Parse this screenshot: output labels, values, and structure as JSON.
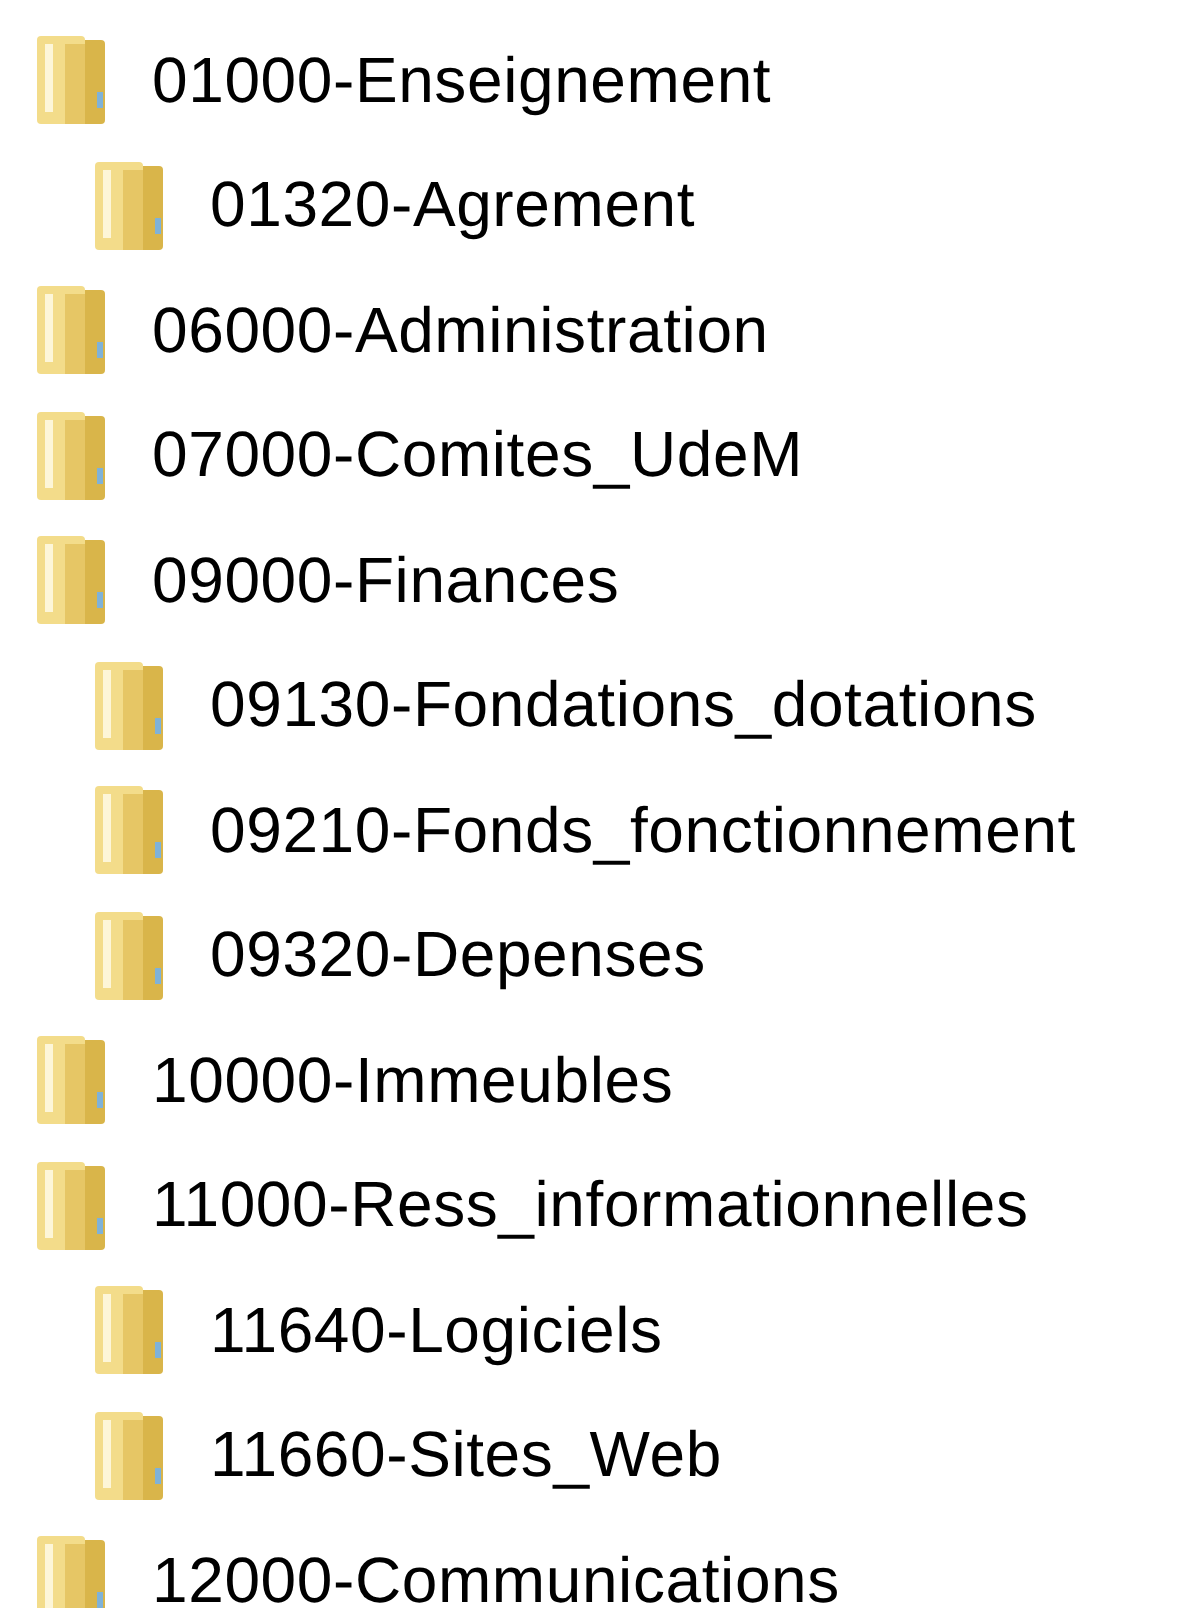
{
  "tree": [
    {
      "label": "01000-Enseignement",
      "children": [
        {
          "label": "01320-Agrement"
        }
      ]
    },
    {
      "label": "06000-Administration"
    },
    {
      "label": "07000-Comites_UdeM"
    },
    {
      "label": "09000-Finances",
      "children": [
        {
          "label": "09130-Fondations_dotations"
        },
        {
          "label": "09210-Fonds_fonctionnement"
        },
        {
          "label": "09320-Depenses"
        }
      ]
    },
    {
      "label": "10000-Immeubles"
    },
    {
      "label": "11000-Ress_informationnelles",
      "children": [
        {
          "label": "11640-Logiciels"
        },
        {
          "label": "11660-Sites_Web"
        }
      ]
    },
    {
      "label": "12000-Communications"
    }
  ]
}
